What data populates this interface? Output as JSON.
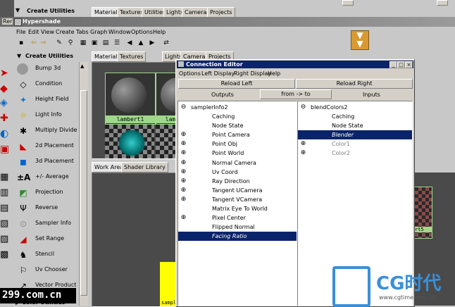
{
  "top_shelf": {
    "create_utilities": "Create Utilities",
    "tabs": [
      "Materials",
      "Textures",
      "Utilities",
      "Lights",
      "Cameras",
      "Projects"
    ],
    "left_tab": "Rer"
  },
  "hypershade": {
    "title": "Hypershade",
    "menu": [
      "File",
      "Edit",
      "View",
      "Create",
      "Tabs",
      "Graph",
      "Window",
      "Options",
      "Help"
    ],
    "create_utilities": "Create Utilities",
    "utilities": [
      "Bump 3d",
      "Condition",
      "Height Field",
      "Light Info",
      "Multiply Divide",
      "2d Placement",
      "3d Placement",
      "+/- Average",
      "Projection",
      "Reverse",
      "Sampler Info",
      "Set Range",
      "Stencil",
      "Uv Chooser",
      "Vector Product"
    ],
    "upper_tabs": [
      "Materials",
      "Textures",
      "Lights",
      "Cameras",
      "Projects"
    ],
    "swatches": [
      "lambert1",
      "lam"
    ],
    "lower_tabs": [
      "Work Area",
      "Shader Library"
    ],
    "node_partial_label": "rt5",
    "yellow_node_label": "sampl",
    "bottom_label": "Color Utilities"
  },
  "connection_editor": {
    "title": "Connection Editor",
    "menu": [
      "Options",
      "Left Display",
      "Right Display",
      "Help"
    ],
    "reload_left": "Reload Left",
    "reload_right": "Reload Right",
    "outputs_label": "Outputs",
    "direction_button": "from -> to",
    "inputs_label": "Inputs",
    "left_node": "samplerInfo2",
    "left_attributes": [
      {
        "label": "Caching",
        "expandable": false,
        "selected": false
      },
      {
        "label": "Node State",
        "expandable": false,
        "selected": false
      },
      {
        "label": "Point Camera",
        "expandable": true,
        "selected": false
      },
      {
        "label": "Point Obj",
        "expandable": true,
        "selected": false
      },
      {
        "label": "Point World",
        "expandable": true,
        "selected": false
      },
      {
        "label": "Normal Camera",
        "expandable": true,
        "selected": false
      },
      {
        "label": "Uv Coord",
        "expandable": true,
        "selected": false
      },
      {
        "label": "Ray Direction",
        "expandable": true,
        "selected": false
      },
      {
        "label": "Tangent UCamera",
        "expandable": true,
        "selected": false
      },
      {
        "label": "Tangent VCamera",
        "expandable": true,
        "selected": false
      },
      {
        "label": "Matrix Eye To World",
        "expandable": false,
        "selected": false
      },
      {
        "label": "Pixel Center",
        "expandable": true,
        "selected": false
      },
      {
        "label": "Flipped Normal",
        "expandable": false,
        "selected": false
      },
      {
        "label": "Facing Ratio",
        "expandable": false,
        "selected": true
      }
    ],
    "right_node": "blendColors2",
    "right_attributes": [
      {
        "label": "Caching",
        "expandable": false,
        "selected": false,
        "grey": false
      },
      {
        "label": "Node State",
        "expandable": false,
        "selected": false,
        "grey": false
      },
      {
        "label": "Blender",
        "expandable": false,
        "selected": true,
        "grey": false
      },
      {
        "label": "Color1",
        "expandable": true,
        "selected": false,
        "grey": true
      },
      {
        "label": "Color2",
        "expandable": true,
        "selected": false,
        "grey": true
      }
    ]
  },
  "watermarks": {
    "left": "299.com.cn",
    "right_brand": "CG时代",
    "right_url": "www.cgtime.com.cn"
  },
  "colors": {
    "selection": "#0a246a",
    "title_bar": "#0a246a",
    "panel_bg": "#c8c8c8",
    "swatch_label_bg": "#9fd88a",
    "yellow_node": "#ffff00"
  }
}
